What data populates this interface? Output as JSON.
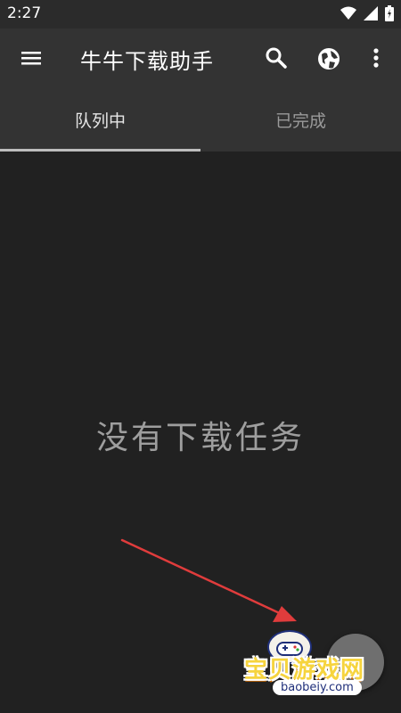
{
  "status_bar": {
    "time": "2:27"
  },
  "app_bar": {
    "title": "牛牛下载助手",
    "icons": [
      "menu-icon",
      "search-icon",
      "globe-icon",
      "more-vert-icon"
    ]
  },
  "tabs": [
    {
      "label": "队列中",
      "active": true
    },
    {
      "label": "已完成",
      "active": false
    }
  ],
  "empty_state": {
    "message": "没有下载任务"
  },
  "watermark": {
    "text": "宝贝游戏网",
    "url": "baobeiy.com"
  },
  "colors": {
    "background": "#212121",
    "app_bar": "#333333",
    "status_bar": "#2b2b2b",
    "arrow": "#e03c3c",
    "fab": "#6f6f6f"
  }
}
